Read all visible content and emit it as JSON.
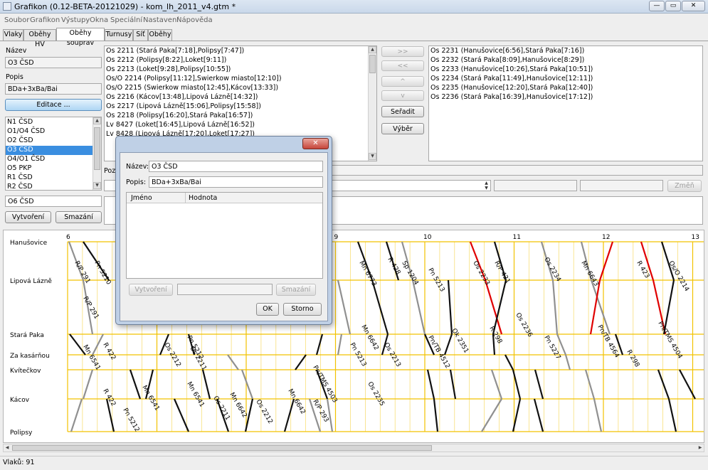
{
  "window": {
    "title": "Grafikon (0.12-BETA-20121029) - kom_lh_2011_v4.gtm *",
    "controls": [
      "—",
      "▭",
      "✕"
    ]
  },
  "menu": [
    "Soubor",
    "Grafikon",
    "Výstupy",
    "Okna",
    "Speciální",
    "Nastavení",
    "Nápověda"
  ],
  "tabs": [
    "Vlaky",
    "Oběhy HV",
    "Oběhy souprav",
    "Turnusy",
    "Síť",
    "Oběhy"
  ],
  "left": {
    "name_label": "Název",
    "name_value": "O3 ČSD",
    "desc_label": "Popis",
    "desc_value": "BDa+3xBa/Bai",
    "edit_button": "Editace ...",
    "circulations": [
      "N1 ČSD",
      "O1/O4 ČSD",
      "O2 ČSD",
      "O3 ČSD",
      "O4/O1 ČSD",
      "O5 PKP",
      "R1 ČSD",
      "R2 ČSD"
    ],
    "selected_index": 3,
    "new_name": "O6 ČSD",
    "create_button": "Vytvoření",
    "delete_button": "Smazání"
  },
  "center": {
    "trains": [
      "Os 2211 (Stará Paka[7:18],Polipsy[7:47])",
      "Os 2212 (Polipsy[8:22],Loket[9:11])",
      "Os 2213 (Loket[9:28],Polipsy[10:55])",
      "Os/O 2214 (Polipsy[11:12],Swierkow miasto[12:10])",
      "Os/O 2215 (Swierkow miasto[12:45],Kácov[13:33])",
      "Os 2216 (Kácov[13:48],Lipová Lázně[14:32])",
      "Os 2217 (Lipová Lázně[15:06],Polipsy[15:58])",
      "Os 2218 (Polipsy[16:20],Stará Paka[16:57])",
      "Lv 8427 (Loket[16:45],Lipová Lázně[16:52])",
      "Lv 8428 (Lipová Lázně[17:20],Loket[17:27])"
    ],
    "position_label": "Pozi",
    "change_button": "Změň"
  },
  "mid_buttons": {
    "add_all": ">>",
    "remove_all": "<<",
    "up": "^",
    "down": "v",
    "sort": "Seřadit",
    "select": "Výběr"
  },
  "right": {
    "trains": [
      "Os 2231 (Hanušovice[6:56],Stará Paka[7:16])",
      "Os 2232 (Stará Paka[8:09],Hanušovice[8:29])",
      "Os 2233 (Hanušovice[10:26],Stará Paka[10:51])",
      "Os 2234 (Stará Paka[11:49],Hanušovice[12:11])",
      "Os 2235 (Hanušovice[12:20],Stará Paka[12:40])",
      "Os 2236 (Stará Paka[16:39],Hanušovice[17:12])"
    ]
  },
  "dialog": {
    "name_label": "Název:",
    "name_value": "O3 ČSD",
    "desc_label": "Popis:",
    "desc_value": "BDa+3xBa/Bai",
    "col_name": "Jméno",
    "col_value": "Hodnota",
    "create_button": "Vytvoření",
    "delete_button": "Smazání",
    "ok_button": "OK",
    "cancel_button": "Storno"
  },
  "graph": {
    "hours": [
      "6",
      "7",
      "8",
      "9",
      "10",
      "11",
      "12",
      "13"
    ],
    "stations": [
      "Hanušovice",
      "Lipová Lázně",
      "Stará Paka",
      "Za kasárňou",
      "Kvítečkov",
      "Kácov",
      "Polipsy"
    ],
    "colors": {
      "grid": "#f2c200",
      "train": "#111111",
      "freight": "#909090",
      "circulation": "#e00000"
    },
    "train_labels": [
      "R/P 291",
      "Pn 5210",
      "R/P 291",
      "Mn 6541",
      "R 422",
      "Pn 5212",
      "Os 2211",
      "Mn 6541",
      "Os 2212",
      "R 422",
      "Pn 5212",
      "Mn 6541",
      "Os 2211",
      "Mn 6642",
      "Os 2212",
      "Mn 6642",
      "Pn/TMS 4503",
      "R/P 293",
      "Pn 5213",
      "Mn 6773",
      "R 428",
      "Sp 1204",
      "Pn 5213",
      "Mn 6642",
      "Os 2213",
      "Os 2235",
      "Pn/TB 4512",
      "Os 2233",
      "R/P 421",
      "R 298",
      "Ok 2351",
      "Os 2234",
      "Os 2236",
      "Pn 5227",
      "Mn 6643",
      "R 423",
      "Os/O 2214",
      "Pn/TB 4564",
      "Pn/TMS 4504",
      "R 298"
    ]
  },
  "status": {
    "trains": "Vlaků: 91"
  }
}
